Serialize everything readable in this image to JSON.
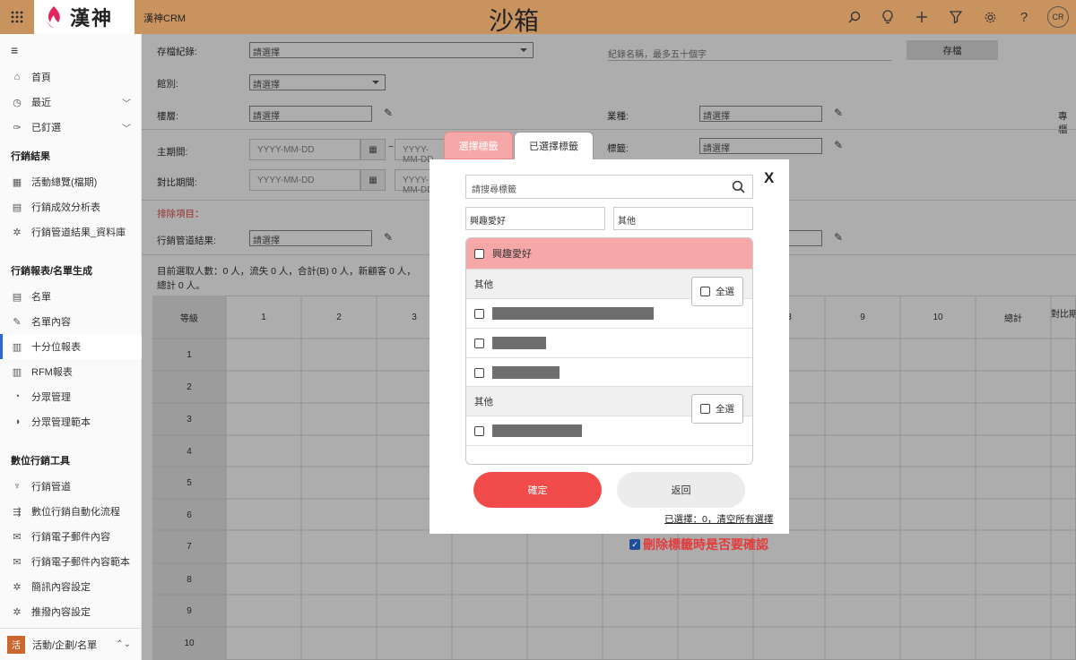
{
  "topbar": {
    "app_name": "漢神CRM",
    "sandbox_label": "沙箱",
    "logo_text": "漢神",
    "avatar": "CR",
    "icons": [
      "search-icon",
      "lightbulb-icon",
      "plus-icon",
      "filter-icon",
      "gear-icon",
      "help-icon"
    ]
  },
  "sidebar": {
    "items": [
      {
        "label": "首頁",
        "icon": "⌂"
      },
      {
        "label": "最近",
        "icon": "◷"
      },
      {
        "label": "已釘選",
        "icon": "✑"
      }
    ],
    "sections": [
      {
        "title": "行銷結果",
        "items": [
          {
            "label": "活動總覽(檔期)",
            "icon": "▦"
          },
          {
            "label": "行銷成效分析表",
            "icon": "▤"
          },
          {
            "label": "行銷管道結果_資料庫",
            "icon": "✲"
          }
        ]
      },
      {
        "title": "行銷報表/名單生成",
        "items": [
          {
            "label": "名單",
            "icon": "▤"
          },
          {
            "label": "名單內容",
            "icon": "✎"
          },
          {
            "label": "十分位報表",
            "icon": "▥"
          },
          {
            "label": "RFM報表",
            "icon": "▥"
          },
          {
            "label": "分眾管理",
            "icon": "◔"
          },
          {
            "label": "分眾管理範本",
            "icon": "◑"
          }
        ]
      },
      {
        "title": "數位行銷工具",
        "items": [
          {
            "label": "行銷管道",
            "icon": "♆"
          },
          {
            "label": "數位行銷自動化流程",
            "icon": "⇶"
          },
          {
            "label": "行銷電子郵件內容",
            "icon": "✉"
          },
          {
            "label": "行銷電子郵件內容範本",
            "icon": "✉"
          },
          {
            "label": "簡訊內容設定",
            "icon": "✲"
          },
          {
            "label": "推撥內容設定",
            "icon": "✲"
          }
        ]
      }
    ],
    "bottom": {
      "badge": "活",
      "label": "活動/企劃/名單"
    }
  },
  "form": {
    "archive_label": "存檔紀錄:",
    "archive_value": "請選擇",
    "record_name_placeholder": "紀錄名稱，最多五十個字",
    "save_button": "存檔",
    "store_label": "館別:",
    "store_value": "請選擇",
    "floor_label": "樓層:",
    "floor_value": "請選擇",
    "industry_label": "業種:",
    "industry_value": "請選擇",
    "counter_label": "專櫃",
    "main_period_label": "主期間:",
    "date_placeholder": "YYYY-MM-DD",
    "tag_label": "標籤:",
    "tag_value": "請選擇",
    "compare_period_label": "對比期間:",
    "exclude_label": "排除項目：",
    "channel_result_label": "行銷管道結果:",
    "channel_result_value": "請選擇",
    "summary_line1": "目前選取人數：0 人，流失 0 人，合計(B) 0 人，新顧客 0 人，",
    "summary_line2": "總計 0 人。"
  },
  "table": {
    "headers": [
      "等級",
      "1",
      "2",
      "3",
      "4",
      "5",
      "6",
      "7",
      "8",
      "9",
      "10",
      "總計",
      "對比期"
    ],
    "rows": [
      "1",
      "2",
      "3",
      "4",
      "5",
      "6",
      "7",
      "8",
      "9",
      "10"
    ]
  },
  "modal": {
    "tab_select": "選擇標籤",
    "tab_selected": "已選擇標籤",
    "close": "X",
    "search_placeholder": "請搜尋標籤",
    "filter_category": "興趣愛好",
    "filter_other": "其他",
    "category": "興趣愛好",
    "groups": [
      {
        "name": "其他",
        "select_all": "全選",
        "rows": [
          180,
          60,
          75
        ]
      },
      {
        "name": "其他",
        "select_all": "全選",
        "rows": [
          100
        ]
      }
    ],
    "confirm_button": "確定",
    "back_button": "返回",
    "status": "已選擇：0，清空所有選擇",
    "confirm_delete": "刪除標籤時是否要確認"
  }
}
